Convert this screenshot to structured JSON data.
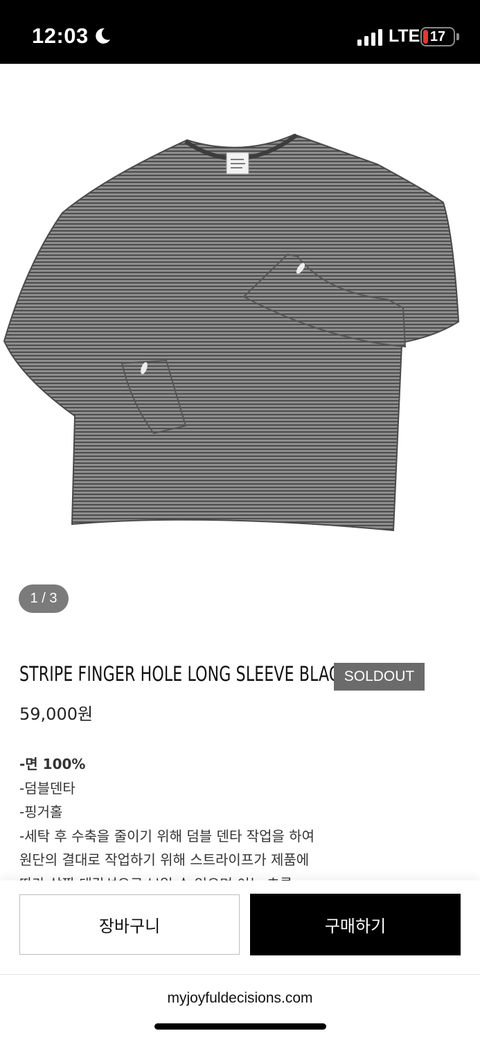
{
  "status_bar": {
    "time": "12:03",
    "moon_icon": "moon-icon",
    "signal_icon": "cellular-signal-icon",
    "network": "LTE",
    "battery_level": "17",
    "battery_fraction": 0.17,
    "battery_color": "#e0393b"
  },
  "gallery": {
    "counter": "1 / 3",
    "image_icon": "striped-long-sleeve-shirt-photo"
  },
  "product": {
    "name": "STRIPE FINGER HOLE LONG SLEEVE BLACK",
    "badge": "SOLDOUT",
    "price": "59,000원",
    "description": [
      "-면 100%",
      "-덤블덴타",
      "-핑거홀",
      "-세탁 후 수축을 줄이기 위해 덤블 덴타 작업을 하여",
      "원단의 결대로 작업하기 위해 스트라이프가 제품에",
      "따라 살짝 대각선으로 보일 수 있으며 이는 초름"
    ]
  },
  "actions": {
    "cart_label": "장바구니",
    "buy_label": "구매하기"
  },
  "browser": {
    "url": "myjoyfuldecisions.com"
  },
  "colors": {
    "badge_bg": "#6b6b6b",
    "buy_bg": "#000000",
    "counter_bg": "#7b7b7b"
  }
}
